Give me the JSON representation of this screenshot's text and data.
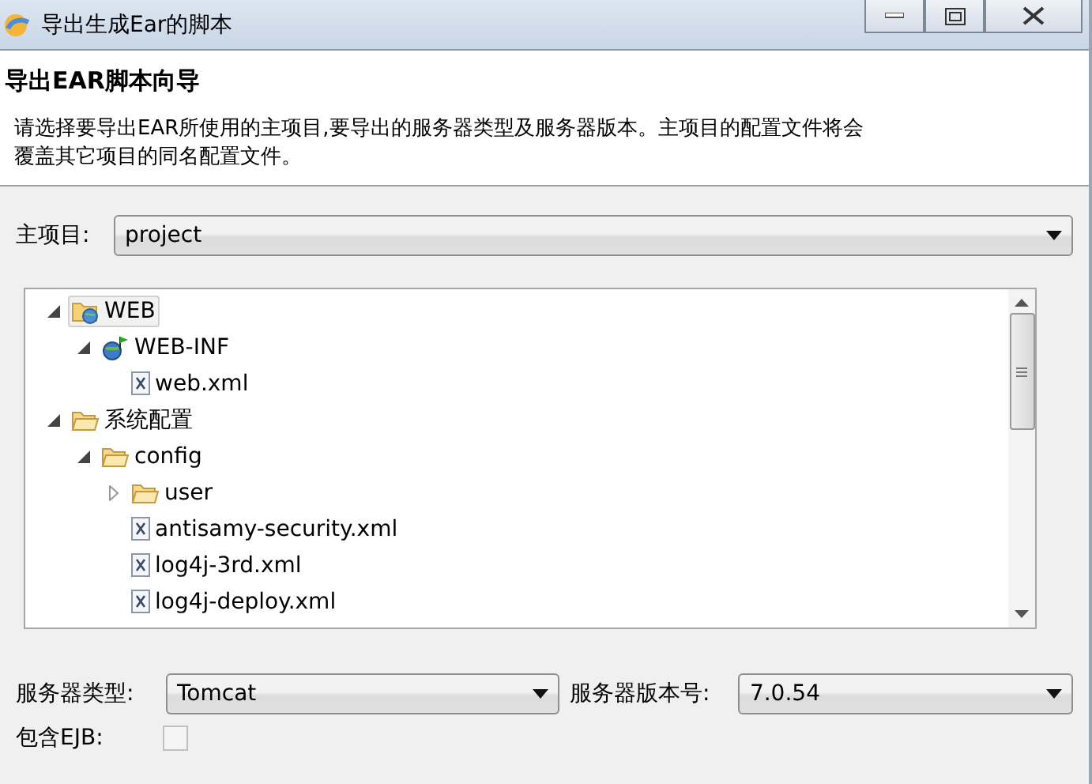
{
  "window": {
    "title": "导出生成Ear的脚本"
  },
  "header": {
    "title": "导出EAR脚本向导",
    "description": "请选择要导出EAR所使用的主项目,要导出的服务器类型及服务器版本。主项目的配置文件将会覆盖其它项目的同名配置文件。"
  },
  "main_project": {
    "label": "主项目:",
    "value": "project"
  },
  "tree": [
    {
      "label": "WEB",
      "kind": "project",
      "expanded": true,
      "selected": true,
      "children": [
        {
          "label": "WEB-INF",
          "kind": "source",
          "expanded": true,
          "selected": false,
          "children": [
            {
              "label": "web.xml",
              "kind": "file",
              "selected": false
            }
          ]
        }
      ]
    },
    {
      "label": "系统配置",
      "kind": "folder",
      "expanded": true,
      "selected": false,
      "children": [
        {
          "label": "config",
          "kind": "folder",
          "expanded": true,
          "selected": false,
          "children": [
            {
              "label": "user",
              "kind": "folder",
              "expanded": false,
              "selected": false
            },
            {
              "label": "antisamy-security.xml",
              "kind": "file",
              "selected": false
            },
            {
              "label": "log4j-3rd.xml",
              "kind": "file",
              "selected": false
            },
            {
              "label": "log4j-deploy.xml",
              "kind": "file",
              "selected": false
            }
          ]
        }
      ]
    }
  ],
  "server_type": {
    "label": "服务器类型:",
    "value": "Tomcat"
  },
  "server_version": {
    "label": "服务器版本号:",
    "value": "7.0.54"
  },
  "include_ejb": {
    "label": "包含EJB:",
    "checked": false
  }
}
